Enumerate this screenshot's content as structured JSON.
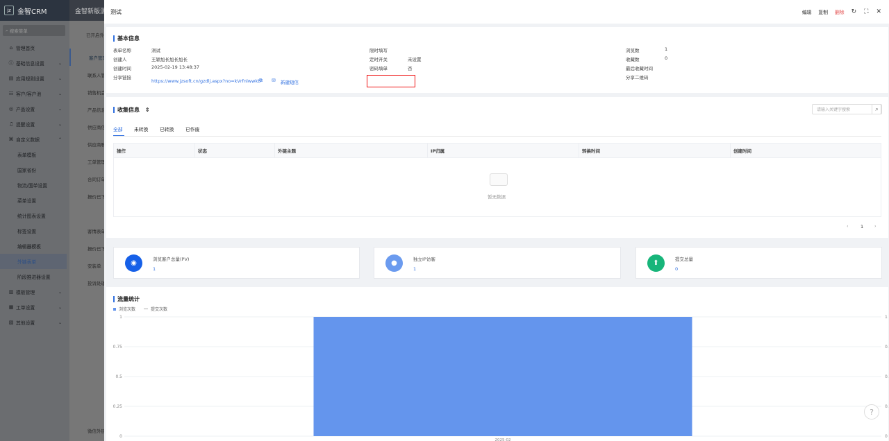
{
  "app": {
    "logo": "金智CRM",
    "tab": "金智新版测"
  },
  "sidebar": {
    "search_placeholder": "搜索菜单",
    "items": [
      {
        "label": "管理首页",
        "icon": "home-icon",
        "glyph": "⌂",
        "chev": ""
      },
      {
        "label": "基础信息设置",
        "icon": "info-icon",
        "glyph": "ⓘ",
        "chev": "⌄"
      },
      {
        "label": "应用规则设置",
        "icon": "doc-icon",
        "glyph": "▤",
        "chev": "⌄"
      },
      {
        "label": "客户/客户池",
        "icon": "people-icon",
        "glyph": "☷",
        "chev": "⌄"
      },
      {
        "label": "产品设置",
        "icon": "product-icon",
        "glyph": "◎",
        "chev": "⌄"
      },
      {
        "label": "提醒设置",
        "icon": "bell-icon",
        "glyph": "♫",
        "chev": "⌄"
      },
      {
        "label": "自定义数据",
        "icon": "custom-data-icon",
        "glyph": "⌘",
        "chev": "⌃"
      }
    ],
    "subitems": [
      "表单模板",
      "国家省份",
      "物流/面单设置",
      "菜单设置",
      "统计图表设置",
      "标签设置",
      "编辑器模板",
      "外链表单",
      "阶段推进器设置"
    ],
    "bottom": [
      {
        "label": "模板管理",
        "icon": "template-icon",
        "glyph": "▥",
        "chev": "⌄"
      },
      {
        "label": "工单设置",
        "icon": "ticket-icon",
        "glyph": "▦",
        "chev": "⌄"
      },
      {
        "label": "其他设置",
        "icon": "other-icon",
        "glyph": "▧",
        "chev": "⌄"
      }
    ]
  },
  "mid": {
    "header": "已开启外",
    "items": [
      "客户管理",
      "联系人管",
      "销售机会",
      "产品信息",
      "供应商信",
      "供应商联",
      "工单管理",
      "合同订单",
      "报价已下",
      "",
      "客情表单",
      "报价已下",
      "安装单",
      "投诉处理"
    ],
    "footer": "微信外链"
  },
  "panel": {
    "title": "测试",
    "actions": {
      "edit": "编辑",
      "copy": "复制",
      "delete": "删除"
    }
  },
  "basic": {
    "title": "基本信息",
    "form_name_label": "表单名称",
    "form_name": "测试",
    "creator_label": "创建人",
    "creator": "王颖加长加长加长",
    "created_label": "创建时间",
    "created": "2025-02-19 13:48:37",
    "share_label": "分享链接",
    "share_url": "https://www.jzsoft.cn/gzdlj.aspx?no=kVrfnlwwkb",
    "new_sms": "新建短信",
    "limit_label": "限时填写",
    "timer_label": "定时开关",
    "timer": "未设置",
    "pwd_label": "密码填单",
    "pwd": "否",
    "views_label": "浏览数",
    "views": "1",
    "favs_label": "收藏数",
    "favs": "0",
    "last_fav_label": "最后收藏时间",
    "qr_label": "分享二维码"
  },
  "collect": {
    "title": "收集信息",
    "search_placeholder": "请输入关键字搜索",
    "tabs": [
      "全部",
      "未转换",
      "已转换",
      "已作废"
    ],
    "columns": [
      "操作",
      "状态",
      "外链主题",
      "IP归属",
      "转换时间",
      "创建时间"
    ],
    "empty": "暂无数据",
    "page": "1"
  },
  "stats": [
    {
      "label": "浏览客户总量(PV)",
      "value": "1",
      "color": "#1660e8",
      "icon": "eye-icon",
      "glyph": "◉"
    },
    {
      "label": "独立IP访客",
      "value": "1",
      "color": "#6b9bef",
      "icon": "user-icon",
      "glyph": "●"
    },
    {
      "label": "提交总量",
      "value": "0",
      "color": "#17b57a",
      "icon": "submit-icon",
      "glyph": "⬆"
    }
  ],
  "traffic": {
    "title": "流量统计"
  },
  "chart_data": {
    "type": "bar",
    "categories": [
      "2025-02"
    ],
    "series": [
      {
        "name": "浏览次数",
        "values": [
          1
        ],
        "color": "#6495ed"
      },
      {
        "name": "提交次数",
        "values": [
          0
        ],
        "color": "#aaaaaa"
      }
    ],
    "yticks": [
      "1",
      "0.75",
      "0.5",
      "0.25",
      "0"
    ],
    "ylim": [
      0,
      1
    ]
  }
}
